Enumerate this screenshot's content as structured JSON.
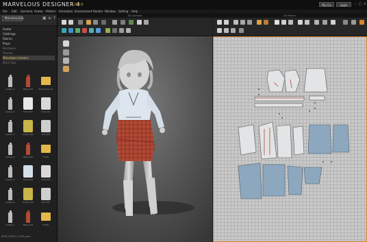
{
  "app": {
    "title": "MARVELOUS DESIGNER 4",
    "version": "4.0.0.0",
    "account_button": "My Clo",
    "help_button": "Login",
    "window_controls": [
      "minimize-icon",
      "maximize-icon",
      "close-icon"
    ]
  },
  "menu": [
    "File",
    "Edit",
    "Garment",
    "Avatar",
    "Pattern",
    "Animation",
    "Environment",
    "Render",
    "Window",
    "Setting",
    "Help"
  ],
  "panels": {
    "library": {
      "title": "Library",
      "tab": "Marvelous/Lib",
      "tree": [
        {
          "label": "Avatar"
        },
        {
          "label": "Clothings"
        },
        {
          "label": "Fabrics"
        },
        {
          "label": "Props"
        },
        {
          "label": "Hardware"
        },
        {
          "label": "Presets"
        },
        {
          "label": "Marvelous Lessons",
          "selected": true
        },
        {
          "label": "Mark Size"
        }
      ],
      "thumbnails": [
        {
          "label": "avatar_1",
          "kind": "avatar"
        },
        {
          "label": "Male_001",
          "kind": "avatar-red"
        },
        {
          "label": "Marvelous Lib",
          "kind": "folder"
        },
        {
          "label": "avatar_2",
          "kind": "avatar"
        },
        {
          "label": "Shirt_001",
          "kind": "document"
        },
        {
          "label": "Coat_001",
          "kind": "coat"
        },
        {
          "label": "avatar_3",
          "kind": "avatar"
        },
        {
          "label": "Dress_001",
          "kind": "dress"
        },
        {
          "label": "Top_001",
          "kind": "top"
        },
        {
          "label": "avatar_4",
          "kind": "avatar"
        },
        {
          "label": "Male_002",
          "kind": "avatar-red"
        },
        {
          "label": "Folder",
          "kind": "folder"
        },
        {
          "label": "avatar_5",
          "kind": "avatar"
        },
        {
          "label": "Shirt_002",
          "kind": "shirt"
        },
        {
          "label": "Coat_002",
          "kind": "coat"
        },
        {
          "label": "avatar_6",
          "kind": "avatar"
        },
        {
          "label": "Dress_002",
          "kind": "dress"
        },
        {
          "label": "Top_002",
          "kind": "top"
        },
        {
          "label": "avatar_7",
          "kind": "avatar"
        },
        {
          "label": "Male_003",
          "kind": "avatar-red"
        },
        {
          "label": "Folder",
          "kind": "folder"
        }
      ],
      "status": "8069_DRESS_1009.pose"
    },
    "view_3d": {
      "title": "3D Garment"
    },
    "view_2d": {
      "title": "2D Pattern"
    }
  },
  "colors": {
    "accent": "#d9822b",
    "fabric_red": "#b24a35",
    "pattern_blue": "#8da8be",
    "blouse": "#dde6ee",
    "avatar": "#cfcfcf"
  }
}
